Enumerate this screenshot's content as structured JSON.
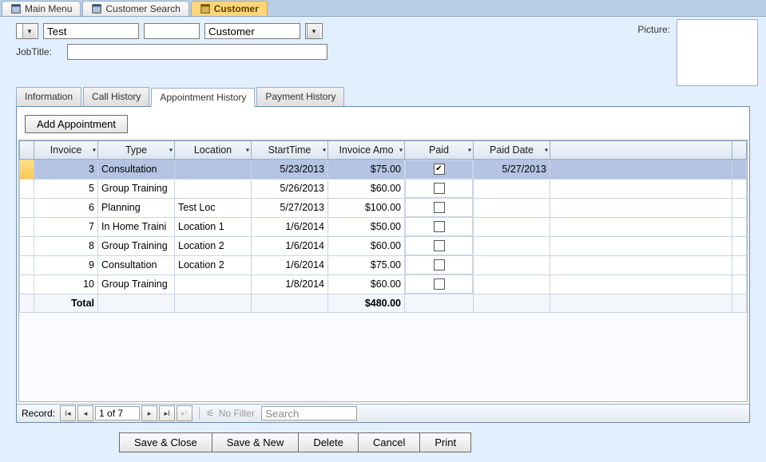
{
  "windowTabs": [
    {
      "label": "Main Menu",
      "active": false
    },
    {
      "label": "Customer Search",
      "active": false
    },
    {
      "label": "Customer",
      "active": true
    }
  ],
  "topForm": {
    "firstNameValue": "Test",
    "middleValue": "",
    "lastNameValue": "Customer",
    "jobTitleLabel": "JobTitle:",
    "jobTitleValue": "",
    "pictureLabel": "Picture:"
  },
  "innerTabs": [
    {
      "label": "Information",
      "active": false
    },
    {
      "label": "Call History",
      "active": false
    },
    {
      "label": "Appointment History",
      "active": true
    },
    {
      "label": "Payment History",
      "active": false
    }
  ],
  "addBtn": "Add Appointment",
  "grid": {
    "headers": [
      "Invoice",
      "Type",
      "Location",
      "StartTime",
      "Invoice Amo",
      "Paid",
      "Paid Date"
    ],
    "rows": [
      {
        "sel": true,
        "invoice": "3",
        "type": "Consultation",
        "loc": "",
        "start": "5/23/2013",
        "amt": "$75.00",
        "paid": true,
        "paidDate": "5/27/2013"
      },
      {
        "sel": false,
        "invoice": "5",
        "type": "Group Training",
        "loc": "",
        "start": "5/26/2013",
        "amt": "$60.00",
        "paid": false,
        "paidDate": ""
      },
      {
        "sel": false,
        "invoice": "6",
        "type": "Planning",
        "loc": "Test Loc",
        "start": "5/27/2013",
        "amt": "$100.00",
        "paid": false,
        "paidDate": ""
      },
      {
        "sel": false,
        "invoice": "7",
        "type": "In Home Traini",
        "loc": "Location 1",
        "start": "1/6/2014",
        "amt": "$50.00",
        "paid": false,
        "paidDate": ""
      },
      {
        "sel": false,
        "invoice": "8",
        "type": "Group Training",
        "loc": "Location 2",
        "start": "1/6/2014",
        "amt": "$60.00",
        "paid": false,
        "paidDate": ""
      },
      {
        "sel": false,
        "invoice": "9",
        "type": "Consultation",
        "loc": "Location 2",
        "start": "1/6/2014",
        "amt": "$75.00",
        "paid": false,
        "paidDate": ""
      },
      {
        "sel": false,
        "invoice": "10",
        "type": "Group Training",
        "loc": "",
        "start": "1/8/2014",
        "amt": "$60.00",
        "paid": false,
        "paidDate": ""
      }
    ],
    "totalLabel": "Total",
    "totalAmt": "$480.00"
  },
  "recNav": {
    "label": "Record:",
    "pos": "1 of 7",
    "filterLabel": "No Filter",
    "searchPlaceholder": "Search"
  },
  "bottomButtons": [
    "Save & Close",
    "Save & New",
    "Delete",
    "Cancel",
    "Print"
  ]
}
